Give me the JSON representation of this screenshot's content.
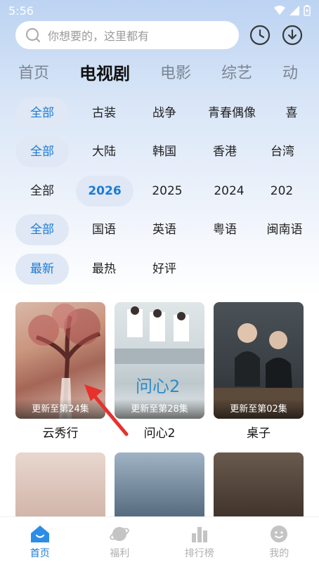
{
  "status": {
    "time": "5:56"
  },
  "search": {
    "placeholder": "你想要的，这里都有"
  },
  "tabs": [
    {
      "label": "首页"
    },
    {
      "label": "电视剧"
    },
    {
      "label": "电影"
    },
    {
      "label": "综艺"
    },
    {
      "label": "动"
    }
  ],
  "filters": {
    "genre": [
      "全部",
      "古装",
      "战争",
      "青春偶像",
      "喜"
    ],
    "region": [
      "全部",
      "大陆",
      "韩国",
      "香港",
      "台湾"
    ],
    "year": [
      "全部",
      "2026",
      "2025",
      "2024",
      "202"
    ],
    "language": [
      "全部",
      "国语",
      "英语",
      "粤语",
      "闽南语"
    ],
    "sort": [
      "最新",
      "最热",
      "好评"
    ]
  },
  "cards": [
    {
      "title": "云秀行",
      "update": "更新至第24集"
    },
    {
      "title": "问心2",
      "update": "更新至第28集"
    },
    {
      "title": "桌子",
      "update": "更新至第02集"
    }
  ],
  "bottom_nav": [
    {
      "label": "首页"
    },
    {
      "label": "福利"
    },
    {
      "label": "排行榜"
    },
    {
      "label": "我的"
    }
  ],
  "colors": {
    "accent": "#1c7bd6",
    "chip_bg": "#dfe8f4"
  }
}
